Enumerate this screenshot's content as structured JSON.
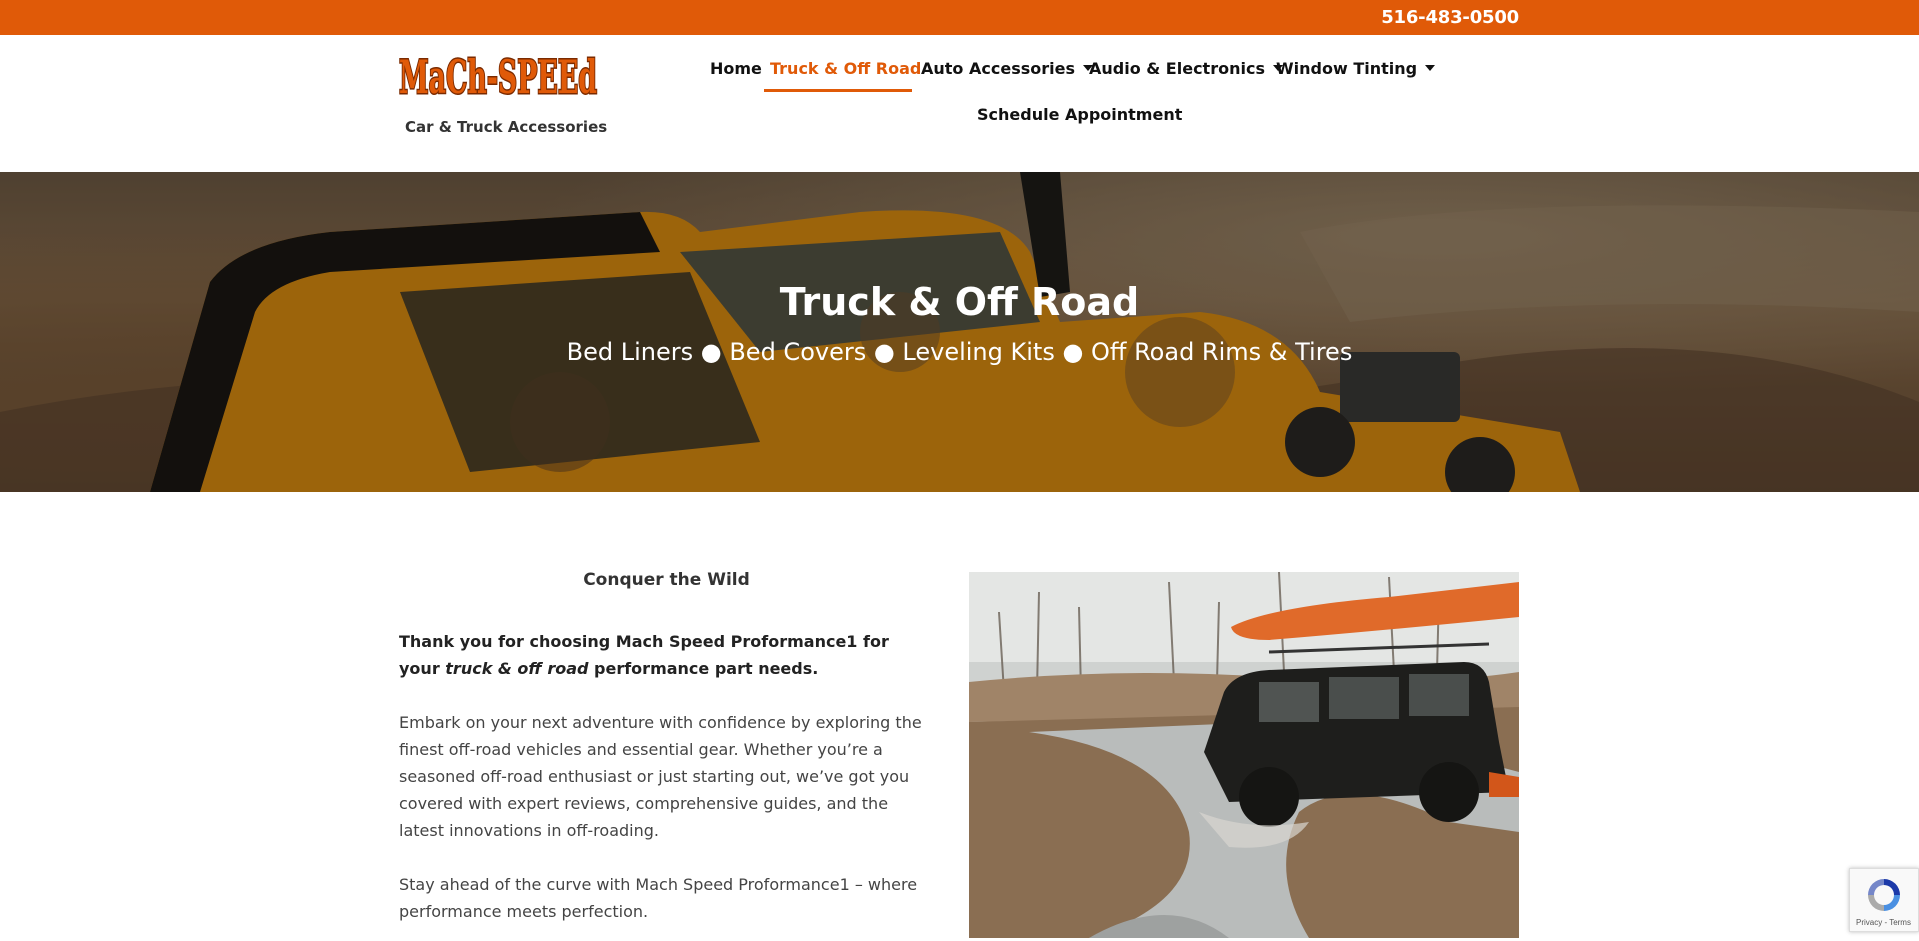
{
  "topbar": {
    "phone": "516-483-0500",
    "color": "#E05A08"
  },
  "brand": {
    "logo_text": "MaCh-SPEEd",
    "tagline": "Car & Truck Accessories"
  },
  "nav": {
    "items": [
      {
        "label": "Home",
        "active": false,
        "has_dropdown": false
      },
      {
        "label": "Truck & Off Road",
        "active": true,
        "has_dropdown": false
      },
      {
        "label": "Auto Accessories",
        "active": false,
        "has_dropdown": true
      },
      {
        "label": "Audio & Electronics",
        "active": false,
        "has_dropdown": true
      },
      {
        "label": "Window Tinting",
        "active": false,
        "has_dropdown": true
      },
      {
        "label": "Schedule Appointment",
        "active": false,
        "has_dropdown": false
      }
    ]
  },
  "hero": {
    "title": "Truck & Off Road",
    "subtitle": "Bed Liners ● Bed Covers ● Leveling Kits ● Off Road Rims & Tires"
  },
  "main": {
    "section_title": "Conquer the Wild",
    "lead_part1": "Thank you for choosing Mach Speed Proformance1 for your ",
    "lead_emph": "truck & off road",
    "lead_part2": " performance part needs.",
    "paragraph1": "Embark on your next adventure with confidence by exploring the finest off-road vehicles and essential gear. Whether you’re a seasoned off-road enthusiast or just starting out, we’ve got you covered with expert reviews, comprehensive guides, and the latest innovations in off-roading.",
    "paragraph2": "Stay ahead of the curve with Mach Speed Proformance1 – where performance meets perfection."
  },
  "recaptcha": {
    "legal": "Privacy - Terms"
  }
}
